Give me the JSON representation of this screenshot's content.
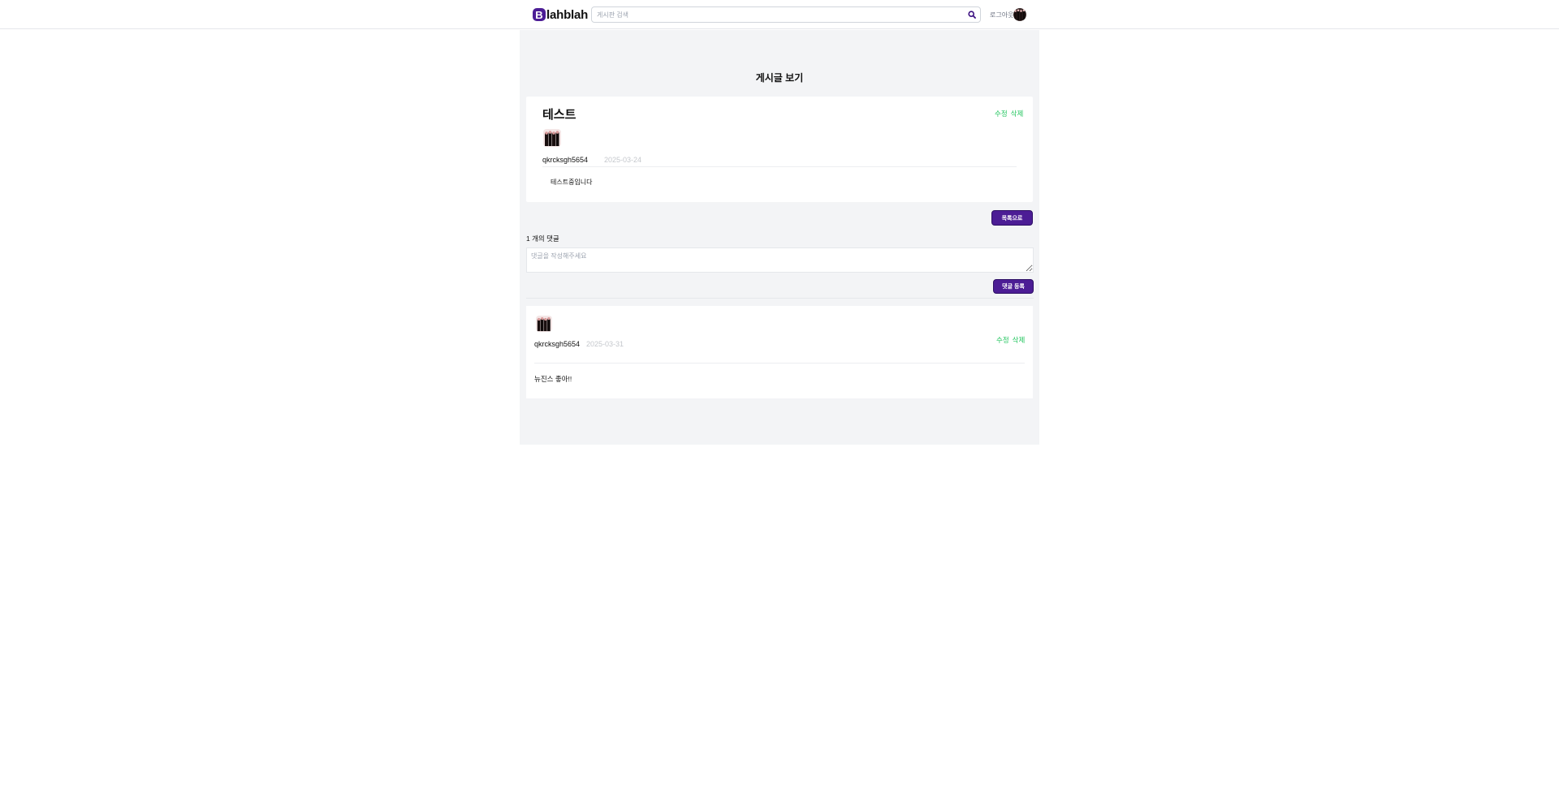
{
  "header": {
    "logo_letter": "B",
    "logo_text": "lahblah",
    "search_placeholder": "게시판 검색",
    "search_icon": "search-icon",
    "logout_label": "로그아웃",
    "accent_color": "#4c1d95"
  },
  "page": {
    "title": "게시글 보기"
  },
  "post": {
    "title": "테스트",
    "author": "qkrcksgh5654",
    "date": "2025-03-24",
    "body": "테스트중입니다",
    "edit_label": "수정",
    "delete_label": "삭제"
  },
  "buttons": {
    "back_to_list": "목록으로",
    "submit_comment": "댓글 등록"
  },
  "comments": {
    "count_label": "1 개의 댓글",
    "input_placeholder": "댓글을 작성해주세요",
    "items": [
      {
        "author": "qkrcksgh5654",
        "date": "2025-03-31",
        "body": "뉴진스 좋아!!",
        "edit_label": "수정",
        "delete_label": "삭제"
      }
    ]
  }
}
